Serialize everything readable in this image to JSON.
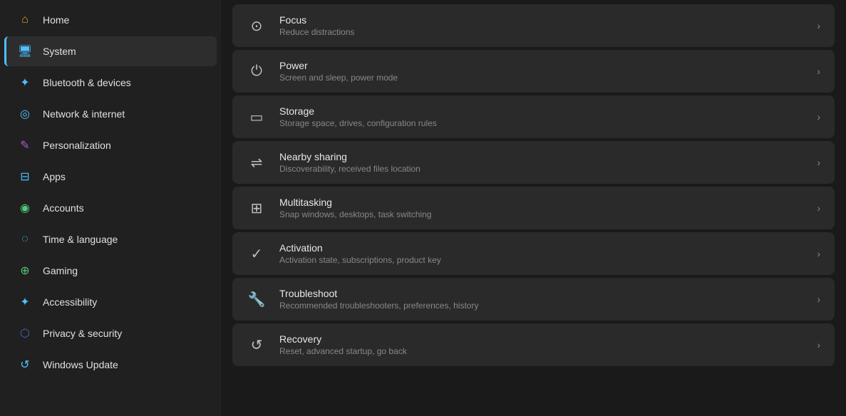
{
  "sidebar": {
    "items": [
      {
        "id": "home",
        "label": "Home",
        "icon": "🏠",
        "iconClass": "icon-home",
        "active": false
      },
      {
        "id": "system",
        "label": "System",
        "icon": "🖥",
        "iconClass": "icon-system",
        "active": true
      },
      {
        "id": "bluetooth",
        "label": "Bluetooth & devices",
        "icon": "🔵",
        "iconClass": "icon-bluetooth",
        "active": false
      },
      {
        "id": "network",
        "label": "Network & internet",
        "icon": "📶",
        "iconClass": "icon-network",
        "active": false
      },
      {
        "id": "personalization",
        "label": "Personalization",
        "icon": "✏",
        "iconClass": "icon-personalization",
        "active": false
      },
      {
        "id": "apps",
        "label": "Apps",
        "icon": "📦",
        "iconClass": "icon-apps",
        "active": false
      },
      {
        "id": "accounts",
        "label": "Accounts",
        "icon": "👤",
        "iconClass": "icon-accounts",
        "active": false
      },
      {
        "id": "time",
        "label": "Time & language",
        "icon": "🌐",
        "iconClass": "icon-time",
        "active": false
      },
      {
        "id": "gaming",
        "label": "Gaming",
        "icon": "🎮",
        "iconClass": "icon-gaming",
        "active": false
      },
      {
        "id": "accessibility",
        "label": "Accessibility",
        "icon": "♿",
        "iconClass": "icon-accessibility",
        "active": false
      },
      {
        "id": "privacy",
        "label": "Privacy & security",
        "icon": "🛡",
        "iconClass": "icon-privacy",
        "active": false
      },
      {
        "id": "update",
        "label": "Windows Update",
        "icon": "🔄",
        "iconClass": "icon-update",
        "active": false
      }
    ]
  },
  "main": {
    "items": [
      {
        "id": "focus",
        "title": "Focus",
        "subtitle": "Reduce distractions",
        "icon": "⊙"
      },
      {
        "id": "power",
        "title": "Power",
        "subtitle": "Screen and sleep, power mode",
        "icon": "⏻"
      },
      {
        "id": "storage",
        "title": "Storage",
        "subtitle": "Storage space, drives, configuration rules",
        "icon": "▭"
      },
      {
        "id": "nearby",
        "title": "Nearby sharing",
        "subtitle": "Discoverability, received files location",
        "icon": "⇌"
      },
      {
        "id": "multitasking",
        "title": "Multitasking",
        "subtitle": "Snap windows, desktops, task switching",
        "icon": "⊞"
      },
      {
        "id": "activation",
        "title": "Activation",
        "subtitle": "Activation state, subscriptions, product key",
        "icon": "✓"
      },
      {
        "id": "troubleshoot",
        "title": "Troubleshoot",
        "subtitle": "Recommended troubleshooters, preferences, history",
        "icon": "🔧"
      },
      {
        "id": "recovery",
        "title": "Recovery",
        "subtitle": "Reset, advanced startup, go back",
        "icon": "↺"
      }
    ]
  }
}
